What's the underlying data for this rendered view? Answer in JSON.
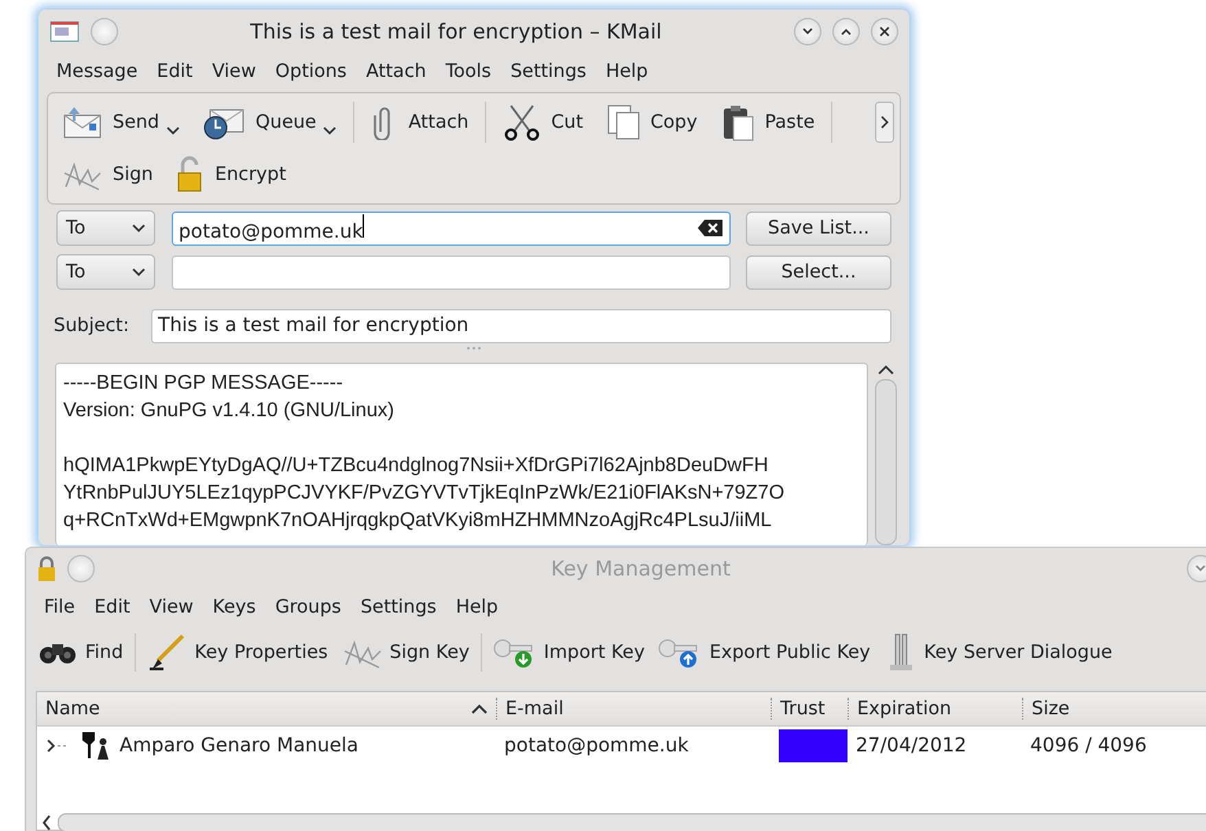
{
  "composer": {
    "title": "This is a test mail for encryption – KMail",
    "active": true,
    "menu": [
      "Message",
      "Edit",
      "View",
      "Options",
      "Attach",
      "Tools",
      "Settings",
      "Help"
    ],
    "toolbar": [
      {
        "kind": "send",
        "label": "Send",
        "dropdown": true
      },
      {
        "kind": "queue",
        "label": "Queue",
        "dropdown": true
      },
      {
        "kind": "attach",
        "label": "Attach",
        "dropdown": false
      },
      {
        "kind": "cut",
        "label": "Cut",
        "dropdown": false
      },
      {
        "kind": "copy",
        "label": "Copy",
        "dropdown": false
      },
      {
        "kind": "paste",
        "label": "Paste",
        "dropdown": false
      },
      {
        "kind": "sign",
        "label": "Sign",
        "dropdown": false
      },
      {
        "kind": "encrypt",
        "label": "Encrypt",
        "dropdown": false
      }
    ],
    "recipients": [
      {
        "type": "To",
        "value": "potato@pomme.uk",
        "focused": true,
        "button": "Save List..."
      },
      {
        "type": "To",
        "focused": false,
        "button": "Select..."
      }
    ],
    "subject_label": "Subject:",
    "subject": "This is a test mail for encryption",
    "body": [
      [
        "-----BEGIN PGP MESSAGE-----",
        "Version: GnuPG v1.4.10 (GNU/Linux)"
      ],
      [
        "hQIMA1PkwpEYtyDgAQ//U+TZBcu4ndglnog7Nsii+XfDrGPi7l62Ajnb8DeuDwFH",
        "YtRnbPulJUY5LEz1qypPCJVYKF/PvZGYVTvTjkEqInPzWk/E21i0FlAKsN+79Z7O",
        "q+RCnTxWd+EMgwpnK7nOAHjrqgkpQatVKyi8mHZHMMNzoAgjRc4PLsuJ/iiML"
      ]
    ]
  },
  "key_manager": {
    "title": "Key Management",
    "active": false,
    "menu": [
      "File",
      "Edit",
      "View",
      "Keys",
      "Groups",
      "Settings",
      "Help"
    ],
    "toolbar": [
      {
        "kind": "find",
        "label": "Find"
      },
      {
        "kind": "properties",
        "label": "Key Properties"
      },
      {
        "kind": "sign",
        "label": "Sign Key"
      },
      {
        "kind": "import",
        "label": "Import Key"
      },
      {
        "kind": "export",
        "label": "Export Public Key"
      },
      {
        "kind": "server",
        "label": "Key Server Dialogue"
      }
    ],
    "columns": [
      {
        "label": "Name",
        "sorted": true
      },
      {
        "label": "E-mail",
        "sorted": false
      },
      {
        "label": "Trust",
        "sorted": false
      },
      {
        "label": "Expiration",
        "sorted": false
      },
      {
        "label": "Size",
        "sorted": false
      }
    ],
    "rows": [
      {
        "name": "Amparo Genaro Manuela",
        "email": "potato@pomme.uk",
        "color": "#3300ff",
        "expiration": "27/04/2012",
        "size": "4096 / 4096",
        "expanded": false
      }
    ]
  }
}
